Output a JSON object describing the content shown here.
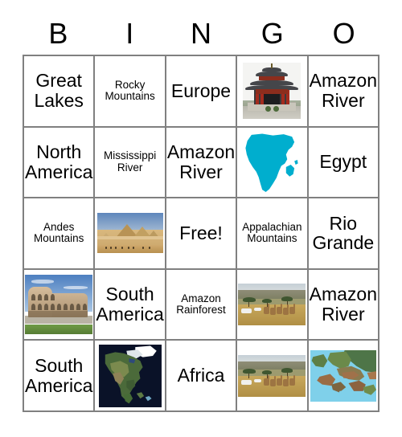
{
  "header": {
    "letters": [
      "B",
      "I",
      "N",
      "G",
      "O"
    ]
  },
  "grid": {
    "rows": 5,
    "columns": 5,
    "border_color": "#808080",
    "background": "#ffffff",
    "cells": [
      [
        {
          "type": "text",
          "text": "Great Lakes",
          "size": "large"
        },
        {
          "type": "text",
          "text": "Rocky Mountains",
          "size": "small"
        },
        {
          "type": "text",
          "text": "Europe",
          "size": "large"
        },
        {
          "type": "image",
          "image": "chinese-pagoda-temple-photo"
        },
        {
          "type": "text",
          "text": "Amazon River",
          "size": "large"
        }
      ],
      [
        {
          "type": "text",
          "text": "North America",
          "size": "large"
        },
        {
          "type": "text",
          "text": "Mississippi River",
          "size": "small"
        },
        {
          "type": "text",
          "text": "Amazon River",
          "size": "large"
        },
        {
          "type": "image",
          "image": "africa-continent-silhouette"
        },
        {
          "type": "text",
          "text": "Egypt",
          "size": "large"
        }
      ],
      [
        {
          "type": "text",
          "text": "Andes Mountains",
          "size": "small"
        },
        {
          "type": "image",
          "image": "pyramids-of-giza-photo"
        },
        {
          "type": "text",
          "text": "Free!",
          "size": "large"
        },
        {
          "type": "text",
          "text": "Appalachian Mountains",
          "size": "small"
        },
        {
          "type": "text",
          "text": "Rio Grande",
          "size": "large"
        }
      ],
      [
        {
          "type": "image",
          "image": "colosseum-rome-photo"
        },
        {
          "type": "text",
          "text": "South America",
          "size": "large"
        },
        {
          "type": "text",
          "text": "Amazon Rainforest",
          "size": "small"
        },
        {
          "type": "image",
          "image": "african-savanna-giraffes-photo"
        },
        {
          "type": "text",
          "text": "Amazon River",
          "size": "large"
        }
      ],
      [
        {
          "type": "text",
          "text": "South America",
          "size": "large"
        },
        {
          "type": "image",
          "image": "north-america-satellite-map"
        },
        {
          "type": "text",
          "text": "Africa",
          "size": "large"
        },
        {
          "type": "image",
          "image": "african-savanna-giraffes-photo"
        },
        {
          "type": "image",
          "image": "europe-physical-map"
        }
      ]
    ]
  },
  "colors": {
    "africa_silhouette": "#00aece",
    "grid_border": "#808080",
    "text": "#000000",
    "page_background": "#ffffff",
    "europe_map_sea": "#7fd0ea",
    "satellite_ocean": "#0a1228"
  }
}
